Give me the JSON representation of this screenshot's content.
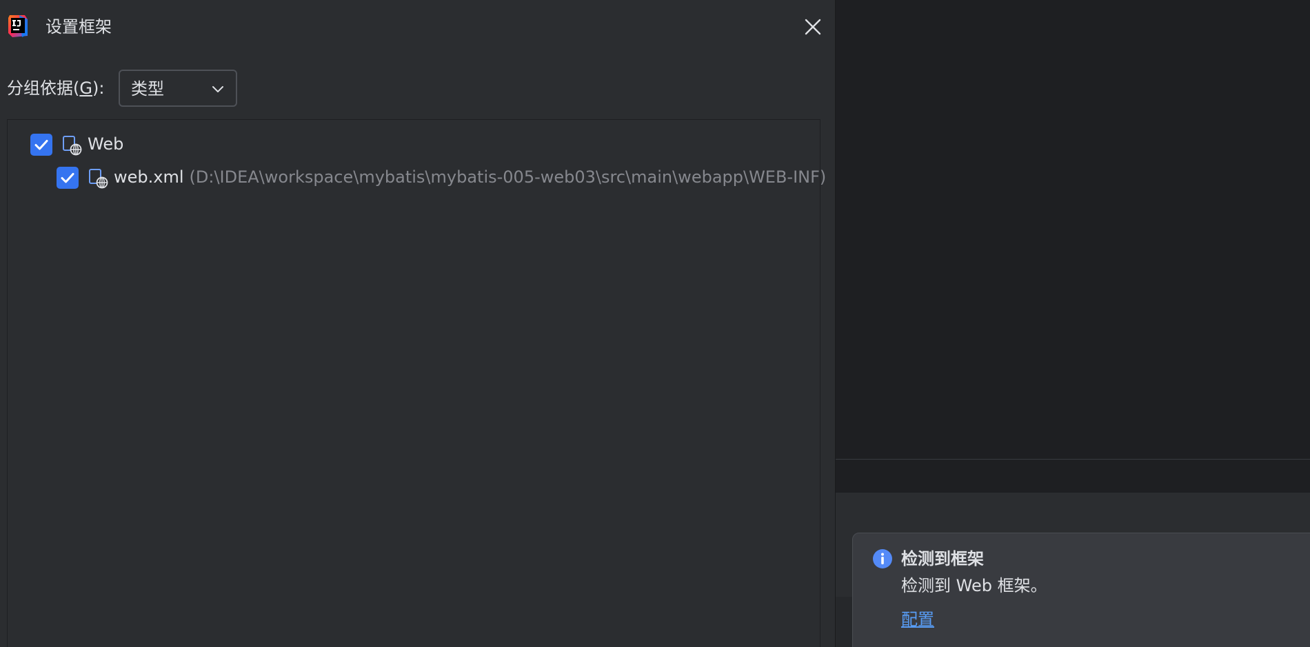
{
  "colors": {
    "dialog_bg": "#2b2d30",
    "ide_bg": "#1e1f22",
    "accent": "#3574f0",
    "text_primary": "#dfe1e5",
    "text_secondary": "#86888e",
    "link": "#589df6",
    "balloon_bg": "#393b40"
  },
  "dialog": {
    "title": "设置框架",
    "app_icon": "intellij-idea-logo",
    "close_icon": "close-icon",
    "group_by": {
      "label_prefix": "分组依据(",
      "label_mnemonic": "G",
      "label_suffix": "):",
      "selected": "类型",
      "chevron_icon": "chevron-down-icon"
    },
    "tree": [
      {
        "label": "Web",
        "path": "",
        "checked": true,
        "icon": "web-framework-icon",
        "level": 0
      },
      {
        "label": "web.xml",
        "path": "(D:\\IDEA\\workspace\\mybatis\\mybatis-005-web03\\src\\main\\webapp\\WEB-INF)",
        "checked": true,
        "icon": "web-xml-icon",
        "level": 1
      }
    ]
  },
  "notification": {
    "icon": "info-icon",
    "title": "检测到框架",
    "message": "检测到 Web 框架。",
    "action": "配置"
  }
}
